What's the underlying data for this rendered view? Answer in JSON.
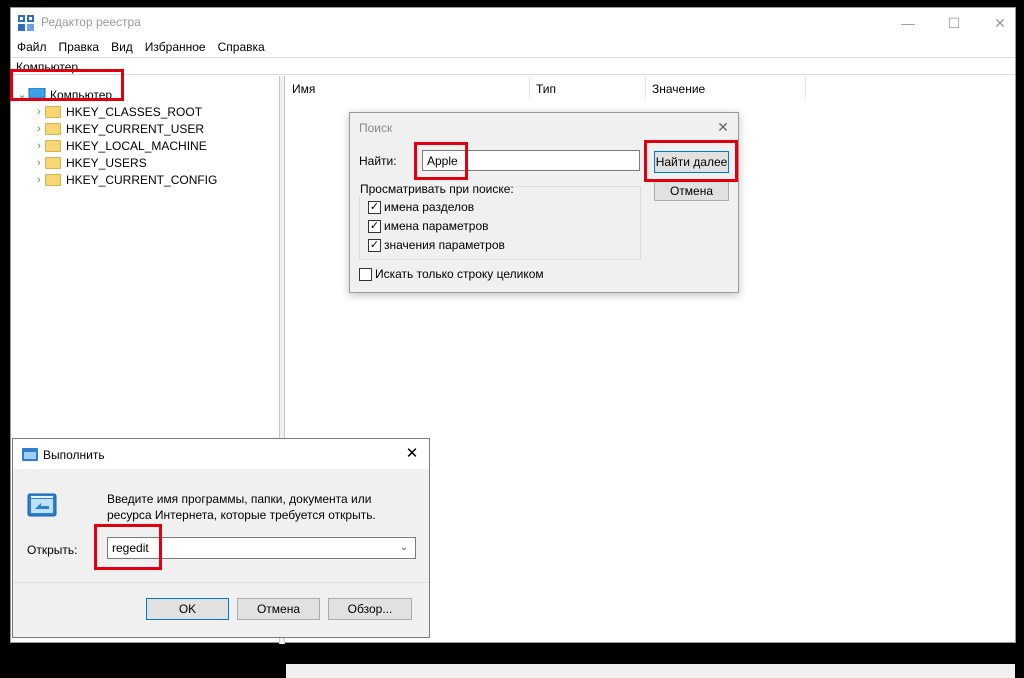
{
  "colors": {
    "highlight": "#e00010",
    "accent": "#0078d7"
  },
  "regedit": {
    "title": "Редактор реестра",
    "menu": [
      "Файл",
      "Правка",
      "Вид",
      "Избранное",
      "Справка"
    ],
    "address": "Компьютер",
    "tree": {
      "root": "Компьютер",
      "items": [
        "HKEY_CLASSES_ROOT",
        "HKEY_CURRENT_USER",
        "HKEY_LOCAL_MACHINE",
        "HKEY_USERS",
        "HKEY_CURRENT_CONFIG"
      ]
    },
    "columns": [
      "Имя",
      "Тип",
      "Значение"
    ]
  },
  "find_dialog": {
    "title": "Поиск",
    "find_label": "Найти:",
    "find_value": "Apple",
    "find_next_label": "Найти далее",
    "cancel_label": "Отмена",
    "group_label": "Просматривать при поиске:",
    "options": [
      {
        "label": "имена разделов",
        "checked": true
      },
      {
        "label": "имена параметров",
        "checked": true
      },
      {
        "label": "значения параметров",
        "checked": true
      }
    ],
    "whole_string": {
      "label": "Искать только строку целиком",
      "checked": false
    }
  },
  "run_dialog": {
    "title": "Выполнить",
    "description": "Введите имя программы, папки, документа или ресурса Интернета, которые требуется открыть.",
    "open_label": "Открыть:",
    "open_value": "regedit",
    "ok_label": "OK",
    "cancel_label": "Отмена",
    "browse_label": "Обзор..."
  }
}
